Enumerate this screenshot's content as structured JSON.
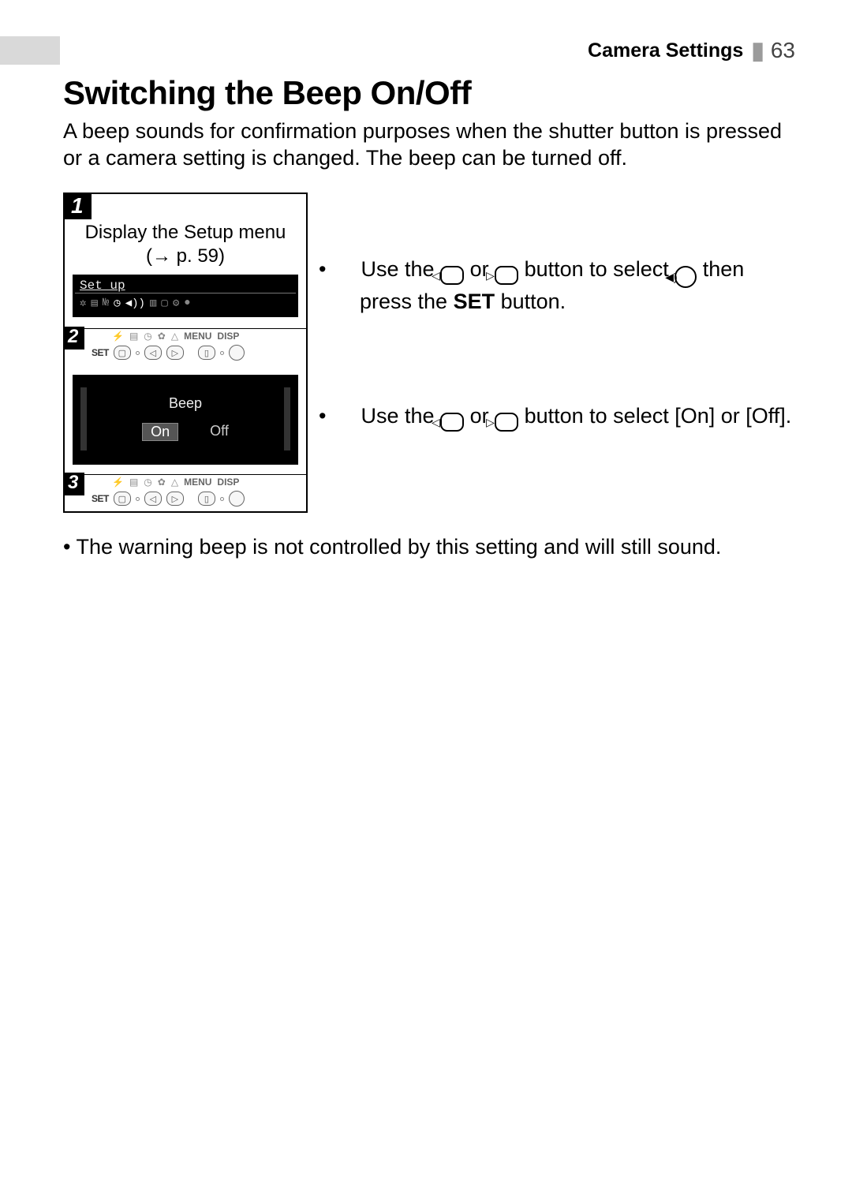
{
  "header": {
    "section": "Camera Settings",
    "page": "63"
  },
  "title": "Switching the Beep On/Off",
  "intro": "A beep sounds for confirmation purposes when the shutter button is pressed or a camera setting is changed. The beep can be turned off.",
  "steps": {
    "s1": {
      "num": "1",
      "caption_l1": "Display the Setup menu",
      "caption_ref": "p. 59",
      "lcd_label": "Set up"
    },
    "s2": {
      "num": "2",
      "set": "SET",
      "menu": "MENU",
      "disp": "DISP",
      "instr_pre": "Use the ",
      "instr_mid": " or ",
      "instr_post": " button to select ",
      "instr_tail": " then press the ",
      "instr_set": "SET",
      "instr_end": " button."
    },
    "beep": {
      "title": "Beep",
      "on": "On",
      "off": "Off"
    },
    "s3": {
      "num": "3",
      "set": "SET",
      "menu": "MENU",
      "disp": "DISP",
      "instr_pre": "Use the ",
      "instr_mid": " or ",
      "instr_post": " button to select [On] or [Off]."
    }
  },
  "note": "The warning beep is not controlled by this setting and will still sound."
}
